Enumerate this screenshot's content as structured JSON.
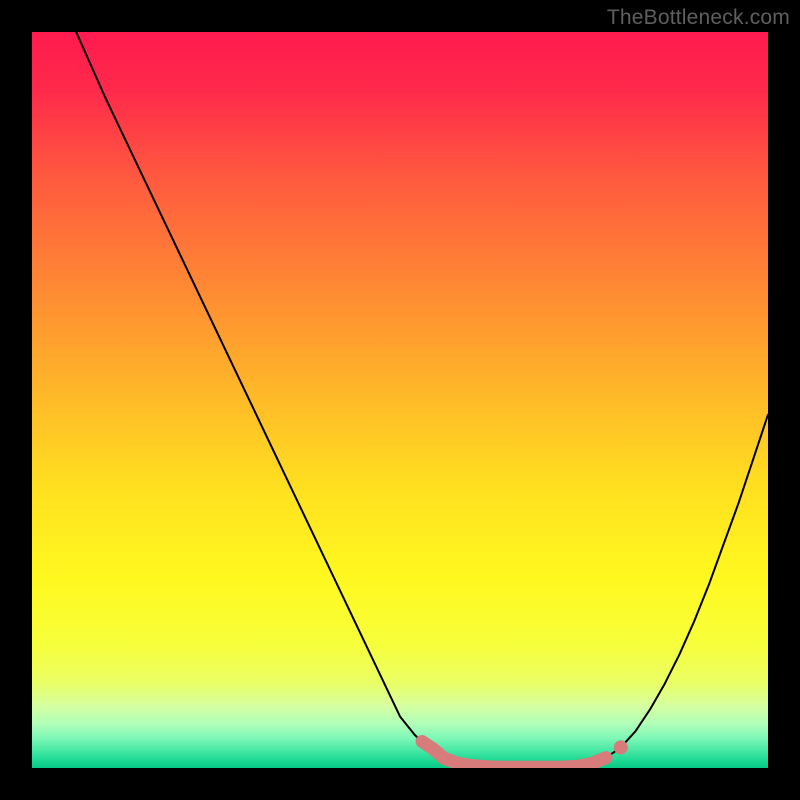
{
  "watermark": "TheBottleneck.com",
  "chart_data": {
    "type": "line",
    "title": "",
    "xlabel": "",
    "ylabel": "",
    "xlim": [
      0,
      100
    ],
    "ylim": [
      0,
      100
    ],
    "grid": false,
    "series": [
      {
        "name": "bottleneck-curve",
        "color": "#000000",
        "x": [
          6,
          10,
          15,
          20,
          25,
          30,
          35,
          40,
          45,
          50,
          52,
          54,
          56,
          58,
          60,
          62,
          64,
          66,
          68,
          70,
          72,
          74,
          76,
          78,
          80,
          82,
          84,
          86,
          88,
          90,
          92,
          94,
          96,
          98,
          100
        ],
        "y": [
          100,
          91,
          80.5,
          70,
          59.5,
          49,
          38.5,
          28,
          17.5,
          7,
          4.5,
          2.5,
          1.3,
          0.6,
          0.3,
          0.15,
          0.1,
          0.1,
          0.1,
          0.1,
          0.12,
          0.22,
          0.6,
          1.4,
          2.8,
          5,
          8,
          11.5,
          15.5,
          20,
          25,
          30.5,
          36,
          42,
          48
        ]
      },
      {
        "name": "bottom-marker-band",
        "color": "#d77b7b",
        "style": "thick",
        "x": [
          53,
          54.5,
          56,
          58,
          60,
          62,
          64,
          66,
          68,
          70,
          72,
          74,
          76,
          78
        ],
        "y": [
          3.6,
          2.6,
          1.3,
          0.6,
          0.3,
          0.15,
          0.1,
          0.1,
          0.1,
          0.1,
          0.12,
          0.22,
          0.6,
          1.4
        ]
      },
      {
        "name": "marker-dot",
        "color": "#d77b7b",
        "style": "dot",
        "x": [
          80
        ],
        "y": [
          2.8
        ]
      }
    ],
    "gradient_stops": [
      {
        "pos": 0.0,
        "color": "#ff1a4f"
      },
      {
        "pos": 0.08,
        "color": "#ff2a4b"
      },
      {
        "pos": 0.2,
        "color": "#ff5a3f"
      },
      {
        "pos": 0.35,
        "color": "#ff8a33"
      },
      {
        "pos": 0.5,
        "color": "#ffbb28"
      },
      {
        "pos": 0.62,
        "color": "#ffe020"
      },
      {
        "pos": 0.74,
        "color": "#fff81f"
      },
      {
        "pos": 0.83,
        "color": "#f7ff3a"
      },
      {
        "pos": 0.885,
        "color": "#eaff66"
      },
      {
        "pos": 0.915,
        "color": "#d6ffa0"
      },
      {
        "pos": 0.94,
        "color": "#b0ffb8"
      },
      {
        "pos": 0.96,
        "color": "#7cf7b6"
      },
      {
        "pos": 0.975,
        "color": "#4be8a6"
      },
      {
        "pos": 0.99,
        "color": "#1bd993"
      },
      {
        "pos": 1.0,
        "color": "#06c884"
      }
    ]
  }
}
